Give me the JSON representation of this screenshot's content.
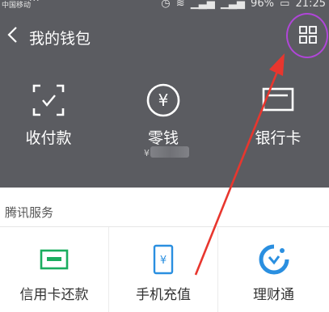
{
  "status_bar": {
    "carrier": "中国移动",
    "dots": "···",
    "battery": "96%",
    "time": "21:25"
  },
  "header": {
    "title": "我的钱包"
  },
  "wallet": {
    "items": [
      {
        "label": "收付款",
        "icon": "scan-pay-icon"
      },
      {
        "label": "零钱",
        "icon": "yen-coin-icon"
      },
      {
        "label": "银行卡",
        "icon": "bank-card-icon"
      }
    ],
    "balance_prefix": "¥"
  },
  "services": {
    "section_title": "腾讯服务",
    "items": [
      {
        "label": "信用卡还款",
        "icon": "credit-card-repay-icon"
      },
      {
        "label": "手机充值",
        "icon": "phone-recharge-icon"
      },
      {
        "label": "理财通",
        "icon": "wealth-management-icon"
      }
    ]
  },
  "colors": {
    "header_bg": "#5b5c61",
    "annotation": "#b046d8",
    "arrow": "#e8362e",
    "green": "#1aad5f",
    "blue": "#2a8fe0"
  }
}
